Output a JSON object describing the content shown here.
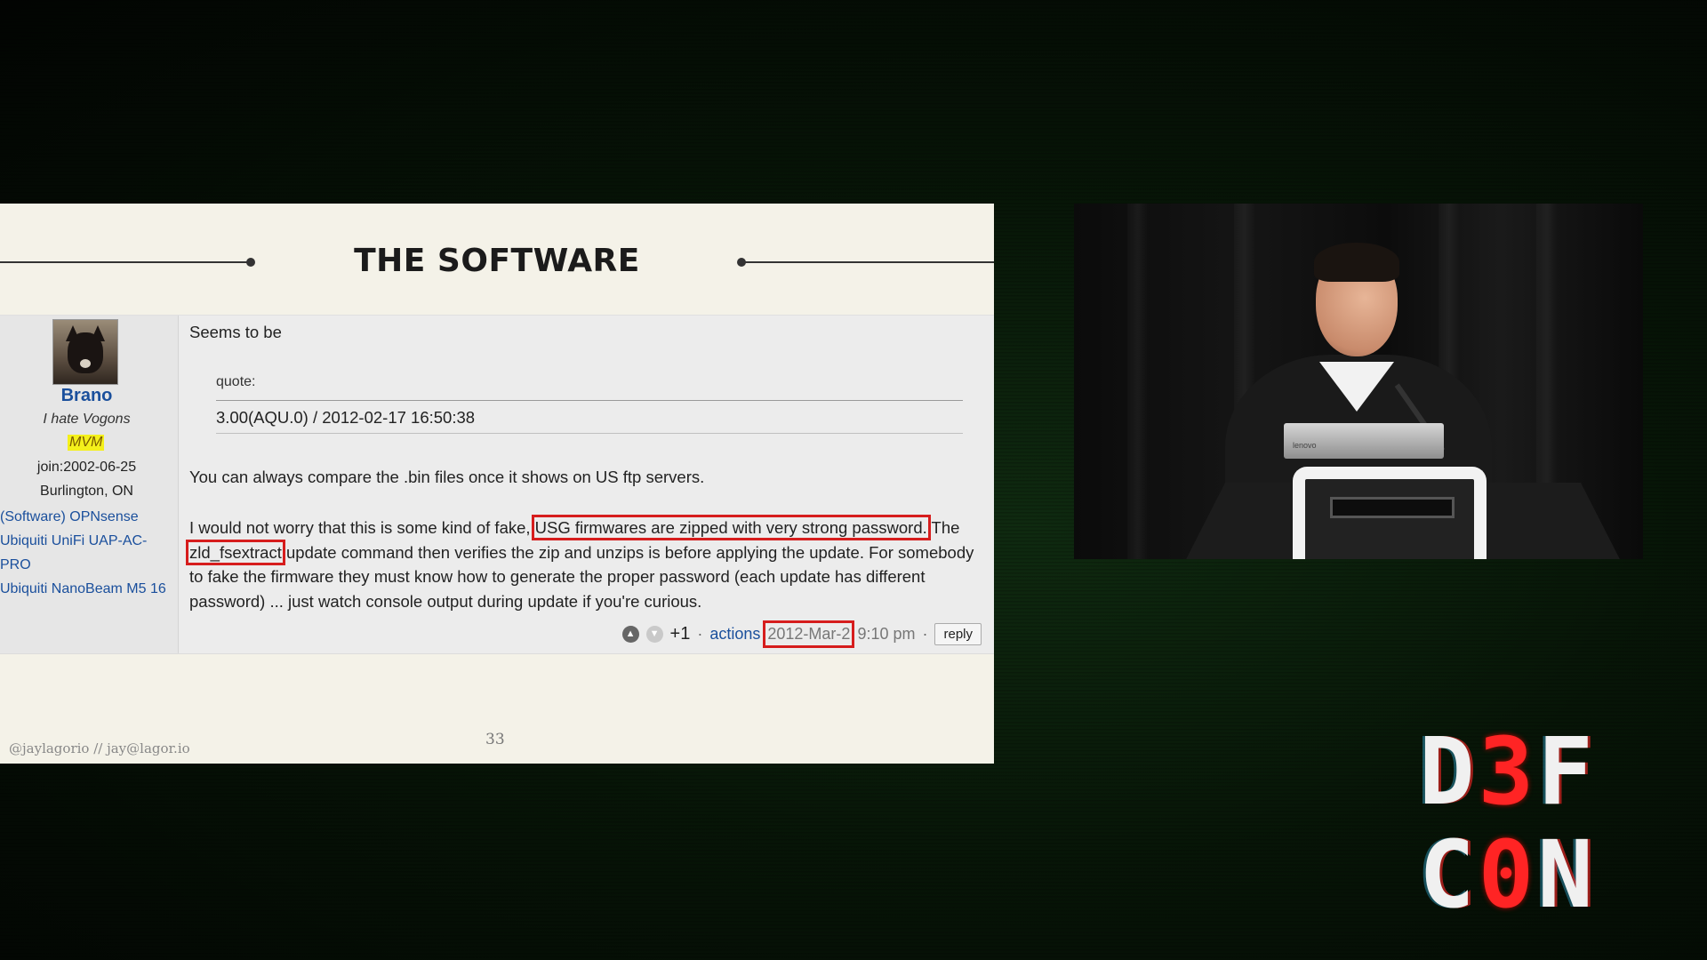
{
  "slide": {
    "title": "THE SOFTWARE",
    "footer_left": "@jaylagorio // jay@lagor.io",
    "page_number": "33"
  },
  "post": {
    "user": {
      "name": "Brano",
      "tagline": "I hate Vogons",
      "rank": "MVM",
      "joined": "join:2002-06-25",
      "location": "Burlington, ON",
      "signature_links": [
        "(Software) OPNsense",
        "Ubiquiti UniFi UAP-AC-PRO",
        "Ubiquiti NanoBeam M5 16"
      ]
    },
    "body": {
      "intro": "Seems to be",
      "quote_label": "quote:",
      "quote_text": "3.00(AQU.0) /  2012-02-17 16:50:38",
      "para1": "You can always compare the .bin files once it shows on US ftp servers.",
      "para2_a": "I would not worry that this is some kind of fake, ",
      "para2_hl1": "USG firmwares are zipped with very strong password.",
      "para2_b": " The ",
      "para2_hl2": "zld_fsextract",
      "para2_c": " update command then verifies the zip and unzips is before applying the update. For somebody to fake the firmware they must know how to generate the proper password (each update has different password) ... just watch console output during update if you're curious."
    },
    "footer": {
      "vote_up_icon": "arrow-up-circle-icon",
      "vote_down_icon": "arrow-down-circle-icon",
      "score": "+1",
      "separator1": "·",
      "actions_label": "actions",
      "date": "2012-Mar-2",
      "time": "9:10 pm",
      "separator2": "·",
      "reply_label": "reply"
    }
  },
  "logo": {
    "line1_a": "D",
    "line1_b": "3",
    "line1_c": "F",
    "line2_a": "C",
    "line2_b": "0",
    "line2_c": "N",
    "accent_color": "#ff2424"
  }
}
